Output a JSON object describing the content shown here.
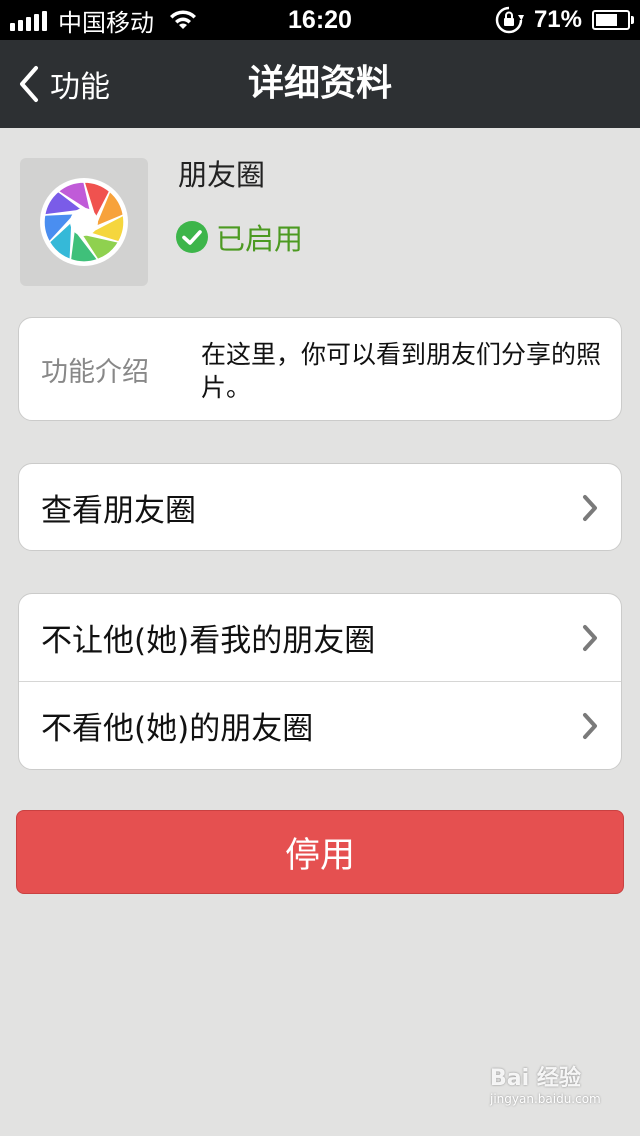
{
  "status_bar": {
    "carrier": "中国移动",
    "time": "16:20",
    "battery": "71%",
    "battery_level": 0.71
  },
  "nav": {
    "back_label": "功能",
    "title": "详细资料"
  },
  "app": {
    "name": "朋友圈",
    "status": "已启用",
    "icon": "moments-aperture-icon"
  },
  "description": {
    "label": "功能介绍",
    "text": "在这里，你可以看到朋友们分享的照片。"
  },
  "rows": {
    "view_moments": "查看朋友圈",
    "block_them_viewing": "不让他(她)看我的朋友圈",
    "hide_their_moments": "不看他(她)的朋友圈"
  },
  "disable_button": "停用",
  "watermark": {
    "main": "Bai 经验",
    "sub": "jingyan.baidu.com"
  },
  "colors": {
    "nav_bg": "#2d3033",
    "page_bg": "#e2e2e1",
    "enabled_green": "#4c9a21",
    "disable_red": "#e55050"
  }
}
